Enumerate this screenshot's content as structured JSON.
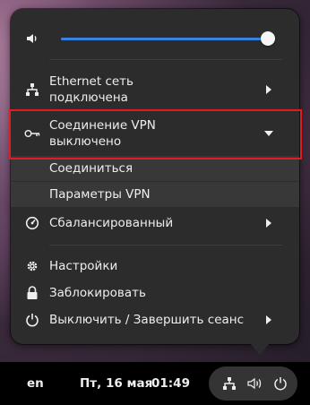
{
  "system_menu": {
    "volume": {
      "level": 1.0
    },
    "ethernet": {
      "title": "Ethernet сеть",
      "status": "подключена"
    },
    "vpn": {
      "title": "Соединение VPN",
      "status": "выключено"
    },
    "vpn_connect": "Соединиться",
    "vpn_settings": "Параметры VPN",
    "power_mode": "Сбалансированный",
    "settings": "Настройки",
    "lock": "Заблокировать",
    "power_off": "Выключить / Завершить сеанс"
  },
  "top_panel": {
    "keyboard_layout": "en",
    "date": "Пт, 16 мая",
    "time": "01:49"
  },
  "colors": {
    "accent": "#3584e4",
    "highlight_border": "#e01b24",
    "menu_bg": "#2c2c2c"
  },
  "icons": [
    "speaker-icon",
    "network-wired-icon",
    "key-icon",
    "power-profile-icon",
    "gear-icon",
    "lock-icon",
    "power-icon",
    "chevron-right-icon",
    "chevron-down-icon",
    "volume-icon"
  ]
}
